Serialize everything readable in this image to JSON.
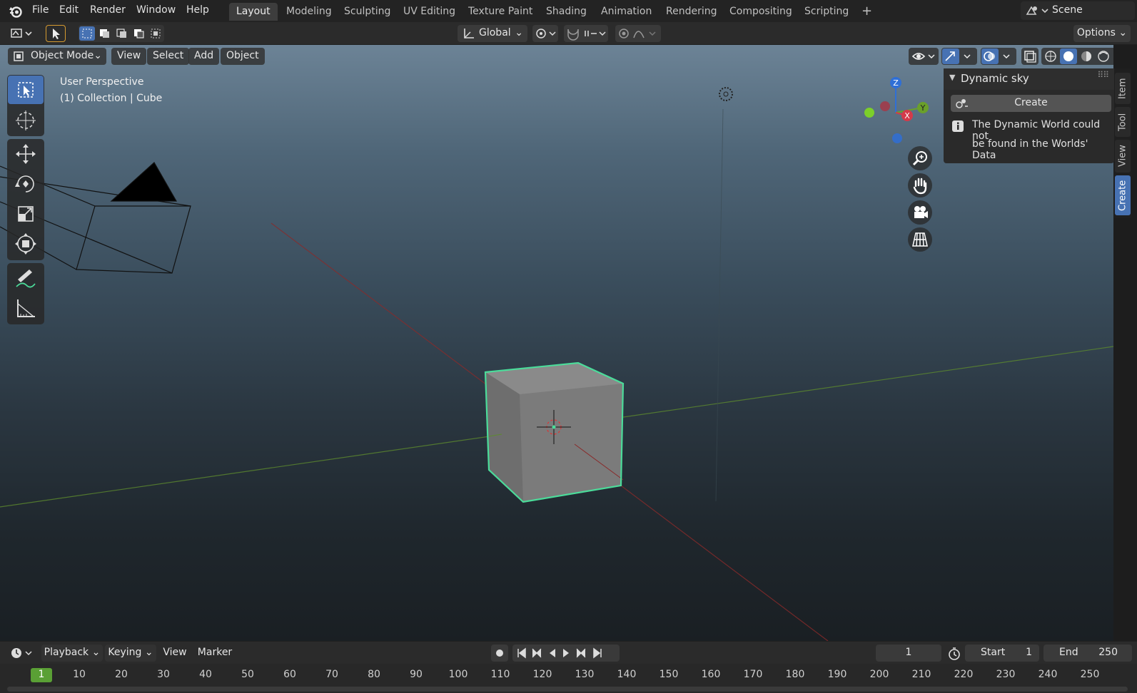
{
  "top_menu": [
    "File",
    "Edit",
    "Render",
    "Window",
    "Help"
  ],
  "workspace_tabs": [
    "Layout",
    "Modeling",
    "Sculpting",
    "UV Editing",
    "Texture Paint",
    "Shading",
    "Animation",
    "Rendering",
    "Compositing",
    "Scripting"
  ],
  "active_workspace": "Layout",
  "scene": "Scene",
  "tool_header": {
    "orientation": "Global",
    "options": "Options"
  },
  "viewport_header": {
    "mode": "Object Mode",
    "menus": [
      "View",
      "Select",
      "Add",
      "Object"
    ]
  },
  "overlay_text": {
    "line1": "User Perspective",
    "line2": "(1) Collection | Cube"
  },
  "gizmo_axes": {
    "z": "Z",
    "y": "Y",
    "x": "X"
  },
  "sidebar": {
    "panel_title": "Dynamic sky",
    "create_button": "Create",
    "info_line1": "The Dynamic World could not",
    "info_line2": "be found in the Worlds' Data",
    "tabs": [
      "Item",
      "Tool",
      "View",
      "Create"
    ],
    "active_tab": "Create"
  },
  "timeline": {
    "menus": [
      "Playback",
      "Keying",
      "View",
      "Marker"
    ],
    "current_frame": "1",
    "start_label": "Start",
    "start": "1",
    "end_label": "End",
    "end": "250",
    "ruler": [
      "1",
      "10",
      "20",
      "30",
      "40",
      "50",
      "60",
      "70",
      "80",
      "90",
      "100",
      "110",
      "120",
      "130",
      "140",
      "150",
      "160",
      "170",
      "180",
      "190",
      "200",
      "210",
      "220",
      "230",
      "240",
      "250"
    ]
  },
  "colors": {
    "accent": "#4772b3",
    "selection_outline": "#4bdc9a",
    "x_axis": "#8a2a2a",
    "y_axis": "#5a8a2a"
  }
}
